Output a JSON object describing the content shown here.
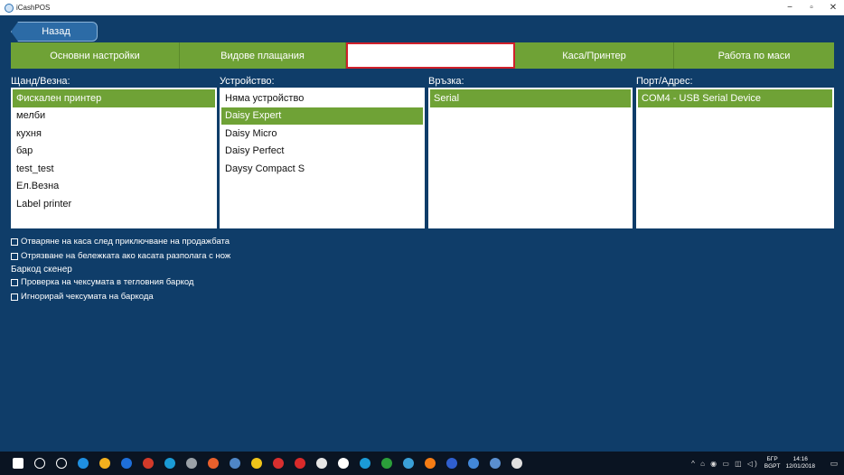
{
  "window": {
    "title": "iCashPOS",
    "minimize": "−",
    "maximize": "▫",
    "close": "✕"
  },
  "back_label": "Назад",
  "tabs": [
    {
      "label": "Основни настройки",
      "active": true
    },
    {
      "label": "Видове плащания",
      "active": true
    },
    {
      "label": "",
      "active": false
    },
    {
      "label": "Каса/Принтер",
      "active": true
    },
    {
      "label": "Работа по маси",
      "active": true
    }
  ],
  "columns": {
    "stand": {
      "label": "Щанд/Везна:",
      "items": [
        "Фискален принтер",
        "мелби",
        "кухня",
        "бар",
        "test_test",
        "Ел.Везна",
        "Label printer"
      ],
      "selected": 0
    },
    "device": {
      "label": "Устройство:",
      "items": [
        "Няма устройство",
        "Daisy Expert",
        "Daisy Micro",
        "Daisy Perfect",
        "Daysy Compact S"
      ],
      "selected": 1
    },
    "connection": {
      "label": "Връзка:",
      "items": [
        "Serial"
      ],
      "selected": 0
    },
    "port": {
      "label": "Порт/Адрес:",
      "items": [
        "COM4 - USB Serial Device"
      ],
      "selected": 0
    }
  },
  "options": {
    "open_drawer": "Отваряне на каса след приключване на продажбата",
    "cut_receipt": "Отрязване на бележката ако касата разполага с нож",
    "barcode_title": "Баркод скенер",
    "check_checksum": "Проверка на чексумата в тегловния баркод",
    "ignore_checksum": "Игнорирай чексумата на баркода"
  },
  "taskbar": {
    "lang_top": "БГР",
    "lang_bottom": "BGPT",
    "time": "14:16",
    "date": "12/01/2018",
    "colors": [
      "#ffffff",
      "#ffffff",
      "#ffffff",
      "#1f8fe0",
      "#f2b01e",
      "#1e6fd9",
      "#d23a2a",
      "#1a9bd6",
      "#9aa1a8",
      "#e8602c",
      "#4f86c6",
      "#f0c419",
      "#d82f2f",
      "#d92a2a",
      "#e6e6e6",
      "#ffffff",
      "#1b9ad6",
      "#2b9f3a",
      "#3aa0d8",
      "#f57c14",
      "#2f5fcf",
      "#4287d8",
      "#5a8fd0",
      "#e0e0e0"
    ],
    "tray_icons": "^ ⌂ ◉ ▭ ◫ ◁)",
    "notification_icon": "▭"
  }
}
